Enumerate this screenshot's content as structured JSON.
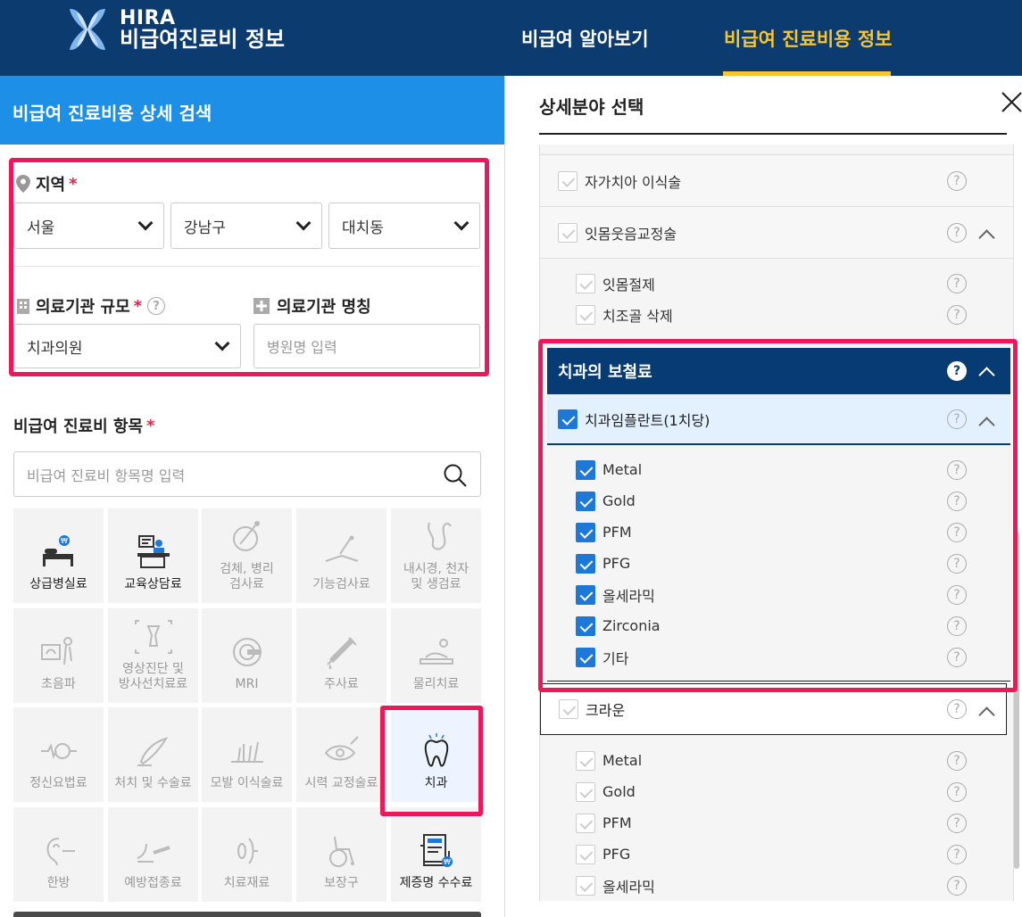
{
  "header": {
    "logo_line1": "HIRA",
    "logo_line2": "비급여진료비 정보",
    "nav": [
      {
        "label": "비급여 알아보기"
      },
      {
        "label": "비급여 진료비용 정보"
      }
    ]
  },
  "left": {
    "title": "비급여 진료비용 상세 검색",
    "region_label": "지역",
    "required": "*",
    "region_selects": [
      "서울",
      "강남구",
      "대치동"
    ],
    "scale_label": "의료기관 규모",
    "scale_value": "치과의원",
    "name_label": "의료기관 명칭",
    "name_placeholder": "병원명 입력",
    "items_label": "비급여 진료비 항목",
    "items_placeholder": "비급여 진료비 항목명 입력",
    "tiles": [
      {
        "label": "상급병실료",
        "icon": "bed-icon"
      },
      {
        "label": "교육상담료",
        "icon": "counsel-icon"
      },
      {
        "label": "검체, 병리\n검사료",
        "icon": "specimen-icon"
      },
      {
        "label": "기능검사료",
        "icon": "function-test-icon"
      },
      {
        "label": "내시경, 천자\n및 생검료",
        "icon": "endoscope-icon"
      },
      {
        "label": "초음파",
        "icon": "ultrasound-icon"
      },
      {
        "label": "영상진단 및\n방사선치료료",
        "icon": "radiology-icon"
      },
      {
        "label": "MRI",
        "icon": "mri-icon"
      },
      {
        "label": "주사료",
        "icon": "syringe-icon"
      },
      {
        "label": "물리치료",
        "icon": "physio-icon"
      },
      {
        "label": "정신요법료",
        "icon": "brain-icon"
      },
      {
        "label": "처치 및 수술료",
        "icon": "surgery-icon"
      },
      {
        "label": "모발 이식술료",
        "icon": "hair-icon"
      },
      {
        "label": "시력 교정술료",
        "icon": "eye-icon"
      },
      {
        "label": "치과",
        "icon": "tooth-icon"
      },
      {
        "label": "한방",
        "icon": "acupuncture-icon"
      },
      {
        "label": "예방접종료",
        "icon": "vaccine-icon"
      },
      {
        "label": "치료재료",
        "icon": "material-icon"
      },
      {
        "label": "보장구",
        "icon": "wheelchair-icon"
      },
      {
        "label": "제증명 수수료",
        "icon": "certificate-icon"
      }
    ]
  },
  "right": {
    "title": "상세분야 선택",
    "rows_top": [
      {
        "label": "자가치아 이식술"
      },
      {
        "label": "잇몸웃음교정술"
      },
      {
        "label": "잇몸절제"
      },
      {
        "label": "치조골 삭제"
      }
    ],
    "section_title": "치과의 보철료",
    "implant_label": "치과임플란트(1치당)",
    "implant_materials": [
      "Metal",
      "Gold",
      "PFM",
      "PFG",
      "올세라믹",
      "Zirconia",
      "기타"
    ],
    "crown_label": "크라운",
    "crown_materials": [
      "Metal",
      "Gold",
      "PFM",
      "PFG",
      "올세라믹"
    ],
    "help": "?"
  }
}
